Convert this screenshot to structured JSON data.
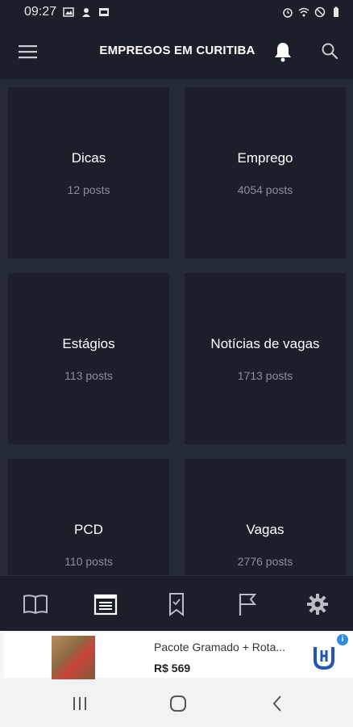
{
  "status_bar": {
    "time": "09:27",
    "icons_left": [
      "image-icon",
      "person-icon",
      "notification-box-icon"
    ],
    "icons_right": [
      "alarm-icon",
      "wifi-icon",
      "do-not-disturb-icon",
      "battery-icon"
    ]
  },
  "header": {
    "title": "EMPREGOS EM CURITIBA",
    "icons": [
      "menu-icon",
      "bell-icon",
      "search-icon"
    ]
  },
  "categories": [
    {
      "title": "Dicas",
      "count": "12 posts"
    },
    {
      "title": "Emprego",
      "count": "4054 posts"
    },
    {
      "title": "Estágios",
      "count": "113 posts"
    },
    {
      "title": "Notícias de vagas",
      "count": "1713 posts"
    },
    {
      "title": "PCD",
      "count": "110 posts"
    },
    {
      "title": "Vagas",
      "count": "2776 posts"
    }
  ],
  "bottom_nav": {
    "items": [
      "book-icon",
      "news-icon",
      "bookmark-icon",
      "flag-icon",
      "gear-icon"
    ],
    "active": "news-icon"
  },
  "ad": {
    "title": "Pacote Gramado + Rota...",
    "price": "R$ 569",
    "info_label": "i"
  },
  "colors": {
    "background": "#252b36",
    "card": "#1c1f2a",
    "count_text": "#8b8f98"
  }
}
